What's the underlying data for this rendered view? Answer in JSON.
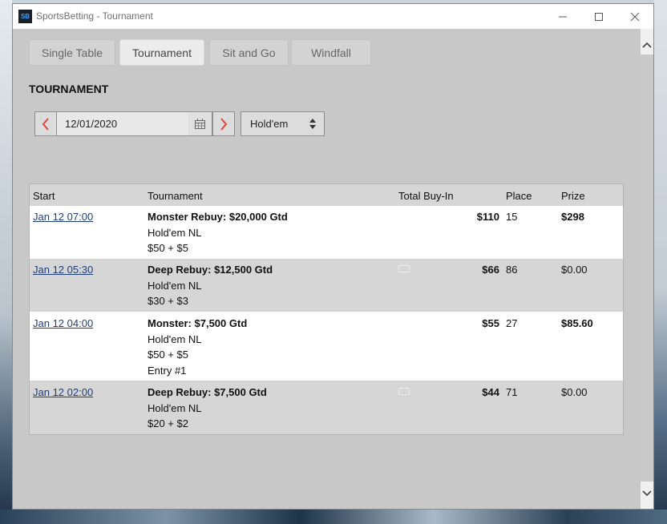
{
  "window": {
    "app_icon_text": "SB",
    "title": "SportsBetting - Tournament",
    "minimize_glyph": "—",
    "maximize_glyph": "☐",
    "close_glyph": "✕"
  },
  "tabs": [
    {
      "label": "Single Table",
      "active": false
    },
    {
      "label": "Tournament",
      "active": true
    },
    {
      "label": "Sit and Go",
      "active": false
    },
    {
      "label": "Windfall",
      "active": false
    }
  ],
  "section_title": "TOURNAMENT",
  "date_picker": {
    "value": "12/01/2020",
    "prev_icon": "chevron-left-icon",
    "next_icon": "chevron-right-icon",
    "calendar_icon": "calendar-icon"
  },
  "game_select": {
    "value": "Hold'em"
  },
  "table": {
    "columns": {
      "start": "Start",
      "tournament": "Tournament",
      "buyin": "Total Buy-In",
      "place": "Place",
      "prize": "Prize"
    },
    "rows": [
      {
        "start": "Jan 12 07:00",
        "name": "Monster Rebuy: $20,000 Gtd",
        "game": "Hold'em NL",
        "fee": "$50 + $5",
        "entry": "",
        "buyin": "$110",
        "place": "15",
        "prize": "$298",
        "prize_bold": true,
        "has_icon": false
      },
      {
        "start": "Jan 12 05:30",
        "name": "Deep Rebuy: $12,500 Gtd",
        "game": "Hold'em NL",
        "fee": "$30 + $3",
        "entry": "",
        "buyin": "$66",
        "place": "86",
        "prize": "$0.00",
        "prize_bold": false,
        "has_icon": true
      },
      {
        "start": "Jan 12 04:00",
        "name": "Monster: $7,500 Gtd",
        "game": "Hold'em NL",
        "fee": "$50 + $5",
        "entry": "Entry #1",
        "buyin": "$55",
        "place": "27",
        "prize": "$85.60",
        "prize_bold": true,
        "has_icon": false
      },
      {
        "start": "Jan 12 02:00",
        "name": "Deep Rebuy: $7,500 Gtd",
        "game": "Hold'em NL",
        "fee": "$20 + $2",
        "entry": "",
        "buyin": "$44",
        "place": "71",
        "prize": "$0.00",
        "prize_bold": false,
        "has_icon": true
      }
    ]
  },
  "colors": {
    "accent_arrow": "#e0463c",
    "link": "#1f3d7a",
    "window_bg": "#c8c8c8"
  }
}
